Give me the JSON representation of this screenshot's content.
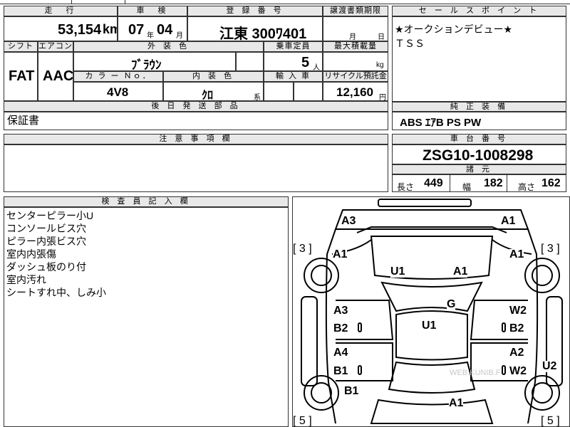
{
  "top_strip": {
    "fragment": ""
  },
  "row1": {
    "mileage_header": "走　行",
    "mileage_value": "53,154",
    "mileage_unit": "km",
    "inspection_header": "車　検",
    "inspection_year": "07",
    "inspection_year_unit": "年",
    "inspection_month": "04",
    "inspection_month_unit": "月",
    "plate_header": "登 録 番 号",
    "plate_value": "江東 300ﾜ401",
    "transfer_header": "譲渡書類期限",
    "transfer_month_unit": "月",
    "transfer_day_unit": "日"
  },
  "row2": {
    "shift_header": "シフト",
    "shift_value": "FAT",
    "ac_header": "エアコン",
    "ac_value": "AAC",
    "exterior_header": "外 装 色",
    "exterior_value": "ﾌﾞﾗｳﾝ",
    "capacity_header": "乗車定員",
    "capacity_value": "5",
    "capacity_unit": "人",
    "load_header": "最大積載量",
    "load_unit": "kg",
    "color_no_header": "カ ラ ー Ｎｏ．",
    "color_no_value": "4V8",
    "interior_header": "内 装 色",
    "interior_value": "ｸﾛ",
    "interior_unit": "系",
    "import_header": "輸 入 車",
    "recycle_header": "リサイクル預託金",
    "recycle_value": "12,160",
    "recycle_unit": "円"
  },
  "sales": {
    "header": "セ ー ル ス ポ イ ン ト",
    "line1": "★オークションデビュー★",
    "line2": "ＴＳＳ"
  },
  "later_parts": {
    "header": "後 日 発 送 部 品",
    "value": "保証書"
  },
  "equipment": {
    "header": "純 正 装 備",
    "value": "ABS ｴｱB PS PW"
  },
  "caution": {
    "header": "注 意 事 項 欄"
  },
  "chassis": {
    "header": "車 台 番 号",
    "value": "ZSG10-1008298"
  },
  "specs": {
    "header": "諸 元",
    "length_label": "長さ",
    "length_value": "449",
    "width_label": "幅",
    "width_value": "182",
    "height_label": "高さ",
    "height_value": "162"
  },
  "inspector": {
    "header": "検 査 員 記 入 欄",
    "notes": [
      "センターピラー小U",
      "コンソールビス穴",
      "ピラー内張ビス穴",
      "室内内張傷",
      "ダッシュ板のり付",
      "室内汚れ",
      "シートすれ中、しみ小"
    ]
  },
  "diagram": {
    "labels": {
      "front_left": "A3",
      "front_right": "A1",
      "tire_fl": "[ 3 ]",
      "tire_fr": "[ 3 ]",
      "fender_l": "A1",
      "fender_r": "A1",
      "hood_l": "U1",
      "hood_r": "A1",
      "windshield": "G",
      "roof": "U1",
      "fdoor_l1": "A3",
      "fdoor_l2": "B2",
      "fdoor_r1": "W2",
      "fdoor_r2": "B2",
      "rdoor_l1": "A4",
      "rdoor_l2": "B1",
      "rdoor_r1": "A2",
      "rdoor_r2": "W2",
      "side_r": "U2",
      "qtr_l": "B1",
      "rear": "A1",
      "tire_rl": "[ 5 ]",
      "tire_rr": "[ 5 ]"
    },
    "watermark": "WEB.KUNIB.F"
  }
}
